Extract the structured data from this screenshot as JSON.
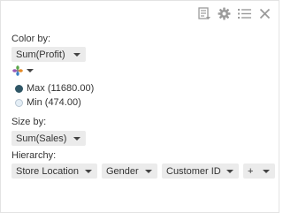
{
  "toolbar": {
    "icons": [
      "export-list-icon",
      "gear-icon",
      "list-settings-icon",
      "close-icon"
    ]
  },
  "color_by": {
    "label": "Color by:",
    "value": "Sum(Profit)",
    "legend": [
      {
        "label": "Max (11680.00)",
        "color": "#2f5666"
      },
      {
        "label": "Min (474.00)",
        "color": "#e4eef6"
      }
    ]
  },
  "size_by": {
    "label": "Size by:",
    "value": "Sum(Sales)"
  },
  "hierarchy": {
    "label": "Hierarchy:",
    "items": [
      "Store Location",
      "Gender",
      "Customer ID"
    ],
    "add_label": "+"
  },
  "colors": {
    "dropdown_bg": "#ebebeb",
    "icon_gray": "#9b9b9b",
    "palette_green": "#5aa54a",
    "palette_orange": "#e58c2a",
    "palette_blue": "#3a7ec6",
    "palette_purple": "#9b59b6"
  }
}
